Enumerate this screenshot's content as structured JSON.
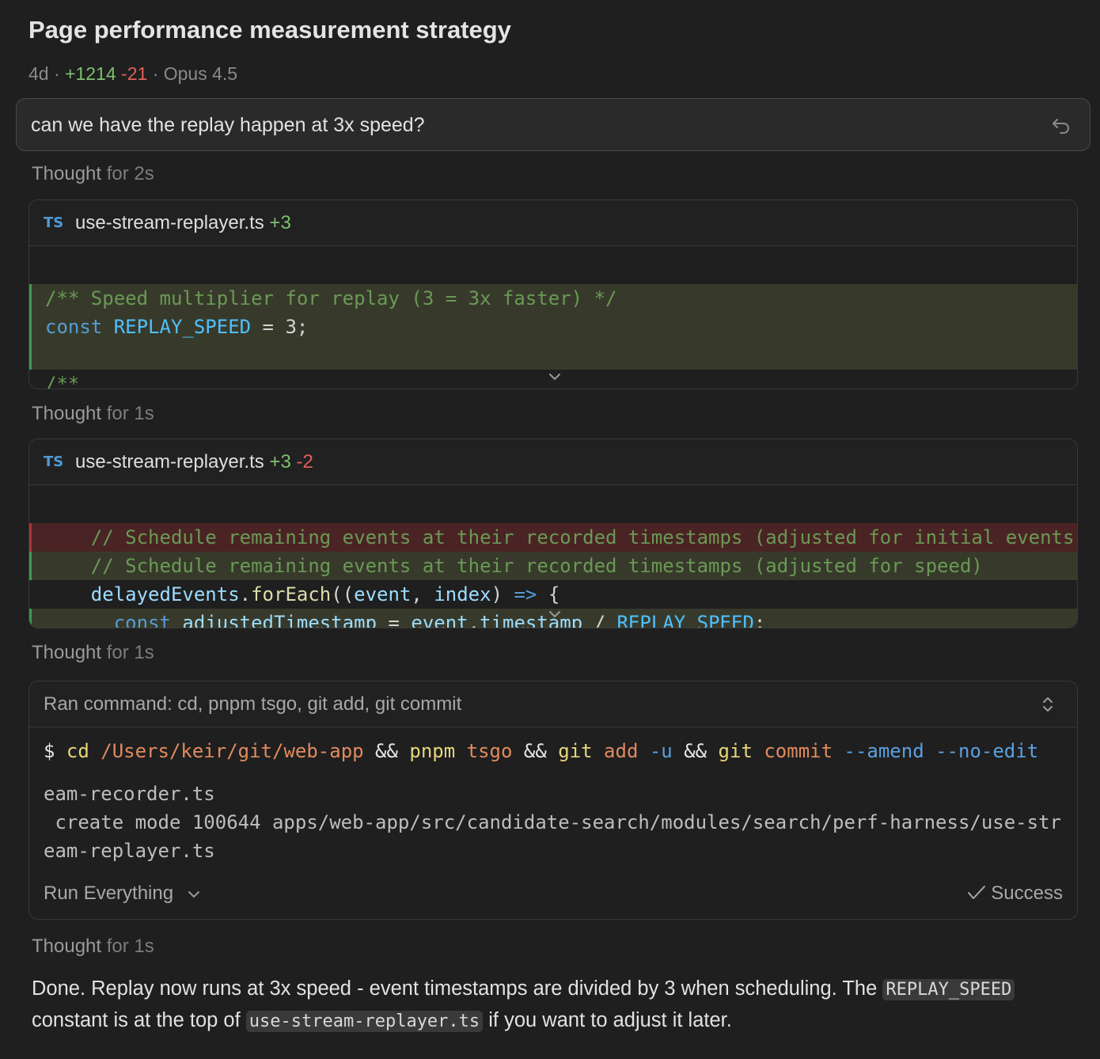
{
  "header": {
    "title": "Page performance measurement strategy",
    "age": "4d",
    "additions": "+1214",
    "deletions": "-21",
    "model": "Opus 4.5"
  },
  "prompt": {
    "text": "can we have the replay happen at 3x speed?",
    "icon": "undo-icon"
  },
  "thoughts": [
    {
      "label": "Thought",
      "duration": "for 2s"
    },
    {
      "label": "Thought",
      "duration": "for 1s"
    },
    {
      "label": "Thought",
      "duration": "for 1s"
    },
    {
      "label": "Thought",
      "duration": "for 1s"
    }
  ],
  "edit1": {
    "lang_badge": "TS",
    "filename": "use-stream-replayer.ts",
    "additions": "+3",
    "lines": [
      {
        "type": "added",
        "tokens": [
          {
            "c": "comment",
            "t": "/** Speed multiplier for replay (3 = 3x faster) */"
          }
        ]
      },
      {
        "type": "added",
        "tokens": [
          {
            "c": "kw",
            "t": "const "
          },
          {
            "c": "const",
            "t": "REPLAY_SPEED"
          },
          {
            "c": "plain",
            "t": " = 3;"
          }
        ]
      },
      {
        "type": "added",
        "tokens": [
          {
            "c": "plain",
            "t": ""
          }
        ]
      },
      {
        "type": "context",
        "tokens": [
          {
            "c": "comment",
            "t": "/**"
          }
        ]
      }
    ]
  },
  "edit2": {
    "lang_badge": "TS",
    "filename": "use-stream-replayer.ts",
    "additions": "+3",
    "deletions": "-2",
    "lines": [
      {
        "type": "removed",
        "tokens": [
          {
            "c": "comment",
            "t": "    // Schedule remaining events at their recorded timestamps (adjusted for initial events"
          }
        ]
      },
      {
        "type": "added",
        "tokens": [
          {
            "c": "comment",
            "t": "    // Schedule remaining events at their recorded timestamps (adjusted for speed)"
          }
        ]
      },
      {
        "type": "context",
        "tokens": [
          {
            "c": "plain",
            "t": "    "
          },
          {
            "c": "var",
            "t": "delayedEvents"
          },
          {
            "c": "plain",
            "t": "."
          },
          {
            "c": "fn",
            "t": "forEach"
          },
          {
            "c": "plain",
            "t": "(("
          },
          {
            "c": "var",
            "t": "event"
          },
          {
            "c": "plain",
            "t": ", "
          },
          {
            "c": "var",
            "t": "index"
          },
          {
            "c": "plain",
            "t": ") "
          },
          {
            "c": "kw",
            "t": "=>"
          },
          {
            "c": "plain",
            "t": " {"
          }
        ]
      },
      {
        "type": "added",
        "tokens": [
          {
            "c": "plain",
            "t": "      "
          },
          {
            "c": "kw",
            "t": "const "
          },
          {
            "c": "var",
            "t": "adjustedTimestamp"
          },
          {
            "c": "plain",
            "t": " = "
          },
          {
            "c": "var",
            "t": "event"
          },
          {
            "c": "plain",
            "t": "."
          },
          {
            "c": "var",
            "t": "timestamp"
          },
          {
            "c": "plain",
            "t": " / "
          },
          {
            "c": "const",
            "t": "REPLAY_SPEED"
          },
          {
            "c": "plain",
            "t": ";"
          }
        ]
      }
    ]
  },
  "command": {
    "header": "Ran command: cd, pnpm tsgo, git add, git commit",
    "prompt_symbol": "$",
    "tokens": [
      {
        "c": "cmd",
        "t": "cd"
      },
      {
        "c": "path",
        "t": " /Users/keir/git/web-app"
      },
      {
        "c": "plain",
        "t": " && "
      },
      {
        "c": "cmd",
        "t": "pnpm"
      },
      {
        "c": "path",
        "t": " tsgo"
      },
      {
        "c": "plain",
        "t": " && "
      },
      {
        "c": "cmd",
        "t": "git"
      },
      {
        "c": "path",
        "t": " add"
      },
      {
        "c": "flag",
        "t": " -u"
      },
      {
        "c": "plain",
        "t": " && "
      },
      {
        "c": "cmd",
        "t": "git"
      },
      {
        "c": "path",
        "t": " commit"
      },
      {
        "c": "flag",
        "t": " --amend"
      },
      {
        "c": "flag",
        "t": " --no-edit"
      }
    ],
    "output": [
      "eam-recorder.ts",
      " create mode 100644 apps/web-app/src/candidate-search/modules/search/perf-harness/use-str",
      "eam-replayer.ts"
    ],
    "run_mode": "Run Everything",
    "status": "Success"
  },
  "final_message": {
    "part1": "Done. Replay now runs at 3x speed - event timestamps are divided by 3 when scheduling. The ",
    "code1": "REPLAY_SPEED",
    "part2": " constant is at the top of ",
    "code2": "use-stream-replayer.ts",
    "part3": " if you want to adjust it later."
  },
  "colors": {
    "background": "#1f1f1f",
    "added_bg": "#373a2b",
    "removed_bg": "#4a2424",
    "add_text": "#7fbf6f",
    "del_text": "#e0605a"
  }
}
